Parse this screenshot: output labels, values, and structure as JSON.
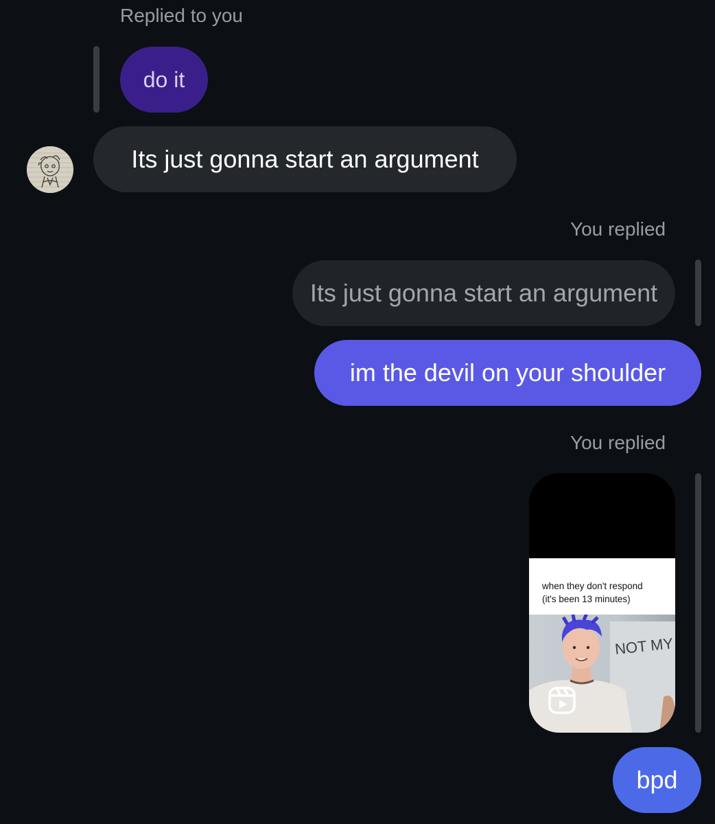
{
  "messages": {
    "replied_to_you_label": "Replied to you",
    "quoted_their_message": "do it",
    "their_message": "Its just gonna start an argument",
    "you_replied_label_1": "You replied",
    "quoted_message_1": "Its just gonna start an argument",
    "your_message_1": "im the devil on your shoulder",
    "you_replied_label_2": "You replied",
    "reel": {
      "caption_line_1": "when they don't respond",
      "caption_line_2": "(it's been 13 minutes)",
      "background_text": "NOT MY IMAGINATION"
    },
    "your_message_2": "bpd"
  },
  "colors": {
    "background": "#0c0f14",
    "quoted_purple": "#3a1f8a",
    "their_bubble": "#24272c",
    "your_bubble_purple": "#5a59e6",
    "your_bubble_blue": "#4c6ae8"
  },
  "icons": {
    "reels": "reels-icon"
  }
}
